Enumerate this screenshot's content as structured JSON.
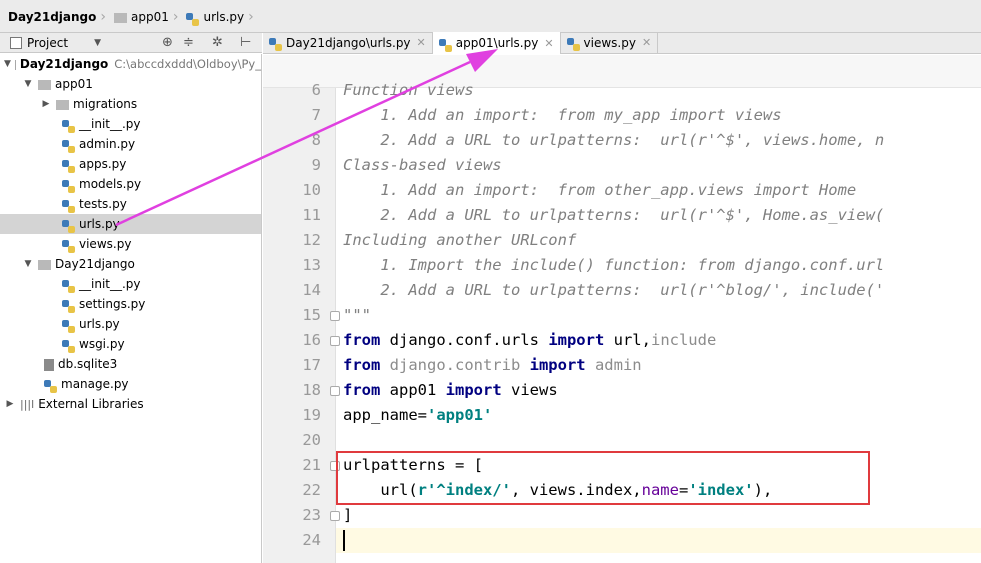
{
  "breadcrumb": {
    "items": [
      "Day21django",
      "app01",
      "urls.py"
    ]
  },
  "project_panel": {
    "title": "Project"
  },
  "tree": {
    "root": {
      "label": "Day21django",
      "path": "C:\\abccdxddd\\Oldboy\\Py_"
    },
    "app01": {
      "label": "app01",
      "children": [
        "migrations",
        "__init__.py",
        "admin.py",
        "apps.py",
        "models.py",
        "tests.py",
        "urls.py",
        "views.py"
      ]
    },
    "day21": {
      "label": "Day21django",
      "children": [
        "__init__.py",
        "settings.py",
        "urls.py",
        "wsgi.py"
      ]
    },
    "files": [
      "db.sqlite3",
      "manage.py"
    ],
    "external": "External Libraries"
  },
  "tabs": [
    {
      "label": "Day21django\\urls.py"
    },
    {
      "label": "app01\\urls.py"
    },
    {
      "label": "views.py"
    }
  ],
  "editor": {
    "line_numbers": [
      "6",
      "7",
      "8",
      "9",
      "10",
      "11",
      "12",
      "13",
      "14",
      "15",
      "16",
      "17",
      "18",
      "19",
      "20",
      "21",
      "22",
      "23",
      "24"
    ],
    "lines": [
      "Function views",
      "    1. Add an import:  from my_app import views",
      "    2. Add a URL to urlpatterns:  url(r'^$', views.home, n",
      "Class-based views",
      "    1. Add an import:  from other_app.views import Home",
      "    2. Add a URL to urlpatterns:  url(r'^$', Home.as_view(",
      "Including another URLconf",
      "    1. Import the include() function: from django.conf.url",
      "    2. Add a URL to urlpatterns:  url(r'^blog/', include('",
      "\"\"\"",
      {
        "kw": "from",
        "rest": " django.conf.urls ",
        "kw2": "import",
        "tail": " url,",
        "gray": "include"
      },
      {
        "kw": "from",
        "rest": " django.contrib ",
        "kw2": "import",
        "tail": " admin"
      },
      {
        "kw": "from",
        "rest": " app01 ",
        "kw2": "import",
        "tail": " views"
      },
      {
        "pre": "app_name=",
        "str": "'app01'"
      },
      "",
      "urlpatterns = [",
      {
        "pre": "    url(",
        "str": "r'^index/'",
        "mid": ", views.index,",
        "name": "name",
        "eq": "=",
        "str2": "'index'",
        "end": "),"
      },
      "]",
      ""
    ]
  }
}
